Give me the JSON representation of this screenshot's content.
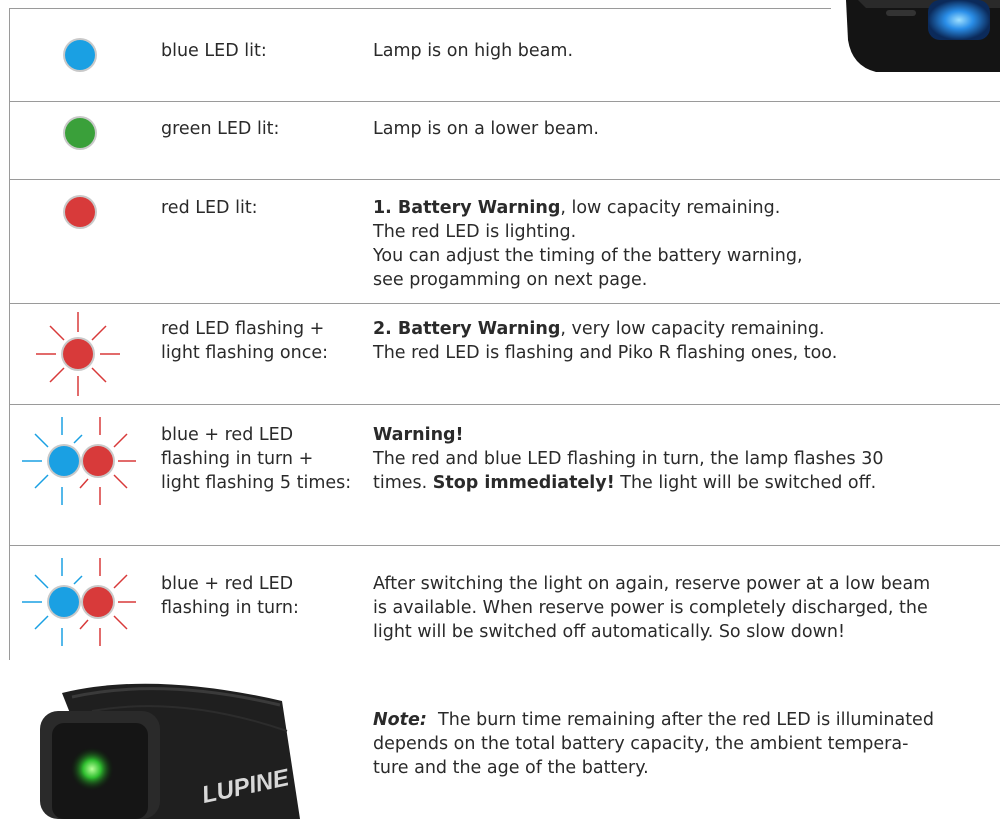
{
  "colors": {
    "blue": "#1aa0e3",
    "green": "#3aa03a",
    "red": "#d83a3a",
    "rule": "#9a9a9a"
  },
  "rows": [
    {
      "status": [
        "blue LED lit:"
      ],
      "meaning": [
        {
          "t": "Lamp is on high beam."
        }
      ]
    },
    {
      "status": [
        "green LED lit:"
      ],
      "meaning": [
        {
          "t": "Lamp is on a lower beam."
        }
      ]
    },
    {
      "status": [
        "red LED lit:"
      ],
      "meaning": [
        {
          "b": "1. Battery Warning",
          "t": ", low capacity remaining."
        },
        {
          "t": "The red LED is lighting."
        },
        {
          "t": "You can adjust the timing of the battery warning,"
        },
        {
          "t": "see progamming on next page."
        }
      ]
    },
    {
      "status": [
        "red LED flashing +",
        "light flashing once:"
      ],
      "meaning": [
        {
          "b": "2. Battery Warning",
          "t": ", very low capacity remaining."
        },
        {
          "t": "The red LED is flashing and Piko R flashing ones, too."
        }
      ]
    },
    {
      "status": [
        "blue + red LED",
        "flashing in turn +",
        "light flashing 5 times:"
      ],
      "meaning": [
        {
          "b": "Warning!"
        },
        {
          "t": "The red and blue LED flashing in turn, the lamp flashes 30"
        },
        {
          "t": "times. ",
          "b2": "Stop immediately!",
          "t2": " The light will be switched off."
        }
      ]
    },
    {
      "status": [
        "blue + red LED",
        "flashing in turn:"
      ],
      "meaning": [
        {
          "t": "After switching the light on again, reserve power at a low beam"
        },
        {
          "t": "is available. When reserve power is completely discharged, the"
        },
        {
          "t": "light will be switched off automatically. So slow down!"
        }
      ]
    }
  ],
  "note": {
    "label": "Note:",
    "lines": [
      "  The burn time remaining after the red LED is illuminated",
      "depends on the total battery capacity, the ambient tempera-",
      "ture and the age of the battery."
    ]
  },
  "headband": {
    "logo": "LUPINE"
  }
}
